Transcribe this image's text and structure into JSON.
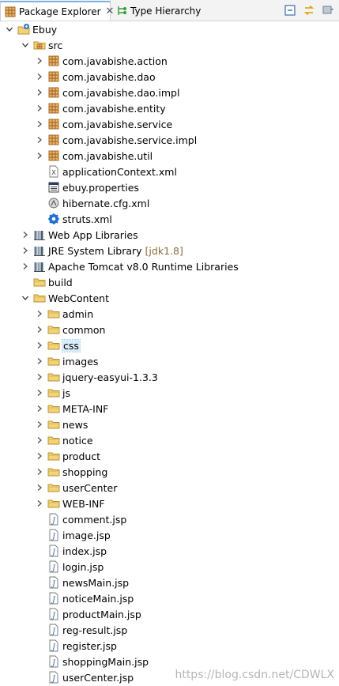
{
  "tabs": {
    "package_explorer": "Package Explorer",
    "package_explorer_close": "✕",
    "type_hierarchy": "Type Hierarchy"
  },
  "colors": {
    "folder": "#e7c56a",
    "package": "#c8873a",
    "selection": "#d9ebf9",
    "decoration": "#8a6a3a"
  },
  "tree": {
    "project": "Ebuy",
    "src": "src",
    "packages": [
      "com.javabishe.action",
      "com.javabishe.dao",
      "com.javabishe.dao.impl",
      "com.javabishe.entity",
      "com.javabishe.service",
      "com.javabishe.service.impl",
      "com.javabishe.util"
    ],
    "src_files": {
      "app_context": "applicationContext.xml",
      "ebuy_props": "ebuy.properties",
      "hibernate_cfg": "hibernate.cfg.xml",
      "struts": "struts.xml"
    },
    "libraries": {
      "webapp": "Web App Libraries",
      "jre": "JRE System Library",
      "jre_decoration": "[jdk1.8]",
      "tomcat": "Apache Tomcat v8.0 Runtime Libraries"
    },
    "build": "build",
    "webcontent": "WebContent",
    "web_folders": [
      "admin",
      "common",
      "css",
      "images",
      "jquery-easyui-1.3.3",
      "js",
      "META-INF",
      "news",
      "notice",
      "product",
      "shopping",
      "userCenter",
      "WEB-INF"
    ],
    "jsp_files": [
      "comment.jsp",
      "image.jsp",
      "index.jsp",
      "login.jsp",
      "newsMain.jsp",
      "noticeMain.jsp",
      "productMain.jsp",
      "reg-result.jsp",
      "register.jsp",
      "shoppingMain.jsp",
      "userCenter.jsp"
    ]
  },
  "watermark": "https://blog.csdn.net/CDWLX"
}
